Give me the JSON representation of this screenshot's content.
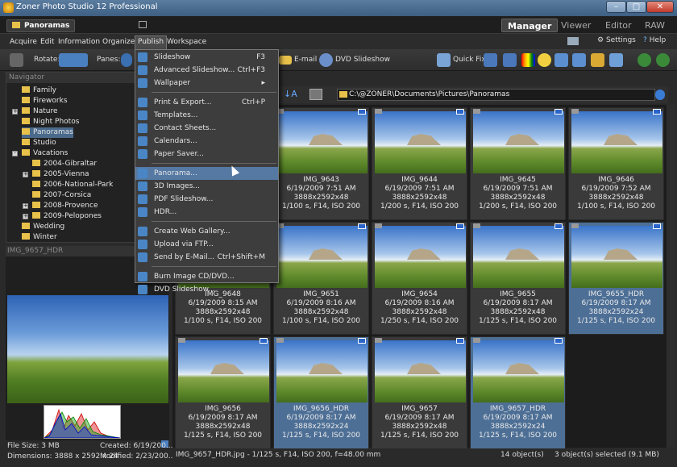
{
  "window": {
    "title": "Zoner Photo Studio 12 Professional",
    "minimize": "–",
    "maximize": "□",
    "close": "✕"
  },
  "topbar": {
    "breadcrumb": "Panoramas",
    "modes": [
      "Manager",
      "Viewer",
      "Editor",
      "RAW"
    ]
  },
  "menu": {
    "items": [
      "Acquire",
      "Edit",
      "Information",
      "Organize",
      "Publish",
      "Workspace"
    ],
    "settings": "Settings",
    "help": "Help"
  },
  "toolbar": {
    "rotate_label": "Rotate:",
    "panes_label": "Panes:",
    "email": "E-mail",
    "dvd": "DVD Slideshow",
    "quickfix": "Quick Fix"
  },
  "navigator": {
    "header": "Navigator",
    "items": [
      {
        "label": "Family",
        "indent": 0,
        "exp": ""
      },
      {
        "label": "Fireworks",
        "indent": 0,
        "exp": ""
      },
      {
        "label": "Nature",
        "indent": 0,
        "exp": "+"
      },
      {
        "label": "Night Photos",
        "indent": 0,
        "exp": ""
      },
      {
        "label": "Panoramas",
        "indent": 0,
        "exp": "",
        "sel": true
      },
      {
        "label": "Studio",
        "indent": 0,
        "exp": ""
      },
      {
        "label": "Vacations",
        "indent": 0,
        "exp": "-"
      },
      {
        "label": "2004-Gibraltar",
        "indent": 1,
        "exp": ""
      },
      {
        "label": "2005-Vienna",
        "indent": 1,
        "exp": "+"
      },
      {
        "label": "2006-National-Park",
        "indent": 1,
        "exp": ""
      },
      {
        "label": "2007-Corsica",
        "indent": 1,
        "exp": ""
      },
      {
        "label": "2008-Provence",
        "indent": 1,
        "exp": "+"
      },
      {
        "label": "2009-Pelopones",
        "indent": 1,
        "exp": "+"
      },
      {
        "label": "Wedding",
        "indent": 0,
        "exp": ""
      },
      {
        "label": "Winter",
        "indent": 0,
        "exp": ""
      }
    ]
  },
  "preview": {
    "title": "IMG_9657_HDR",
    "filesize": "File Size: 3 MB",
    "created": "Created: 6/19/200...",
    "dimensions": "Dimensions: 3888 x 2592 x 24",
    "modified": "Modified: 2/23/200..."
  },
  "path": "C:\\@ZONER\\Documents\\Pictures\\Panoramas",
  "dropdown": [
    {
      "label": "Slideshow",
      "key": "F3"
    },
    {
      "label": "Advanced Slideshow...",
      "key": "Ctrl+F3"
    },
    {
      "label": "Wallpaper",
      "key": "▸"
    },
    {
      "sep": true
    },
    {
      "label": "Print & Export...",
      "key": "Ctrl+P"
    },
    {
      "label": "Templates...",
      "key": ""
    },
    {
      "label": "Contact Sheets...",
      "key": ""
    },
    {
      "label": "Calendars...",
      "key": ""
    },
    {
      "label": "Paper Saver...",
      "key": ""
    },
    {
      "sep": true
    },
    {
      "label": "Panorama...",
      "key": "",
      "hl": true
    },
    {
      "label": "3D Images...",
      "key": ""
    },
    {
      "label": "PDF Slideshow...",
      "key": ""
    },
    {
      "label": "HDR...",
      "key": ""
    },
    {
      "sep": true
    },
    {
      "label": "Create Web Gallery...",
      "key": ""
    },
    {
      "label": "Upload via FTP...",
      "key": ""
    },
    {
      "label": "Send by E-Mail...",
      "key": "Ctrl+Shift+M"
    },
    {
      "sep": true
    },
    {
      "label": "Burn Image CD/DVD...",
      "key": ""
    },
    {
      "label": "DVD Slideshow...",
      "key": ""
    }
  ],
  "thumbs": [
    {
      "name": "IMG_9643",
      "date": "6/19/2009 7:51 AM",
      "dims": "3888x2592x48",
      "exif": "1/100 s, F14, ISO 200"
    },
    {
      "name": "IMG_9644",
      "date": "6/19/2009 7:51 AM",
      "dims": "3888x2592x48",
      "exif": "1/200 s, F14, ISO 200"
    },
    {
      "name": "IMG_9645",
      "date": "6/19/2009 7:51 AM",
      "dims": "3888x2592x48",
      "exif": "1/200 s, F14, ISO 200"
    },
    {
      "name": "IMG_9646",
      "date": "6/19/2009 7:52 AM",
      "dims": "3888x2592x48",
      "exif": "1/100 s, F14, ISO 200"
    },
    {
      "name": "IMG_9648",
      "date": "6/19/2009 8:15 AM",
      "dims": "3888x2592x48",
      "exif": "1/100 s, F14, ISO 200"
    },
    {
      "name": "IMG_9651",
      "date": "6/19/2009 8:16 AM",
      "dims": "3888x2592x48",
      "exif": "1/100 s, F14, ISO 200"
    },
    {
      "name": "IMG_9654",
      "date": "6/19/2009 8:16 AM",
      "dims": "3888x2592x48",
      "exif": "1/250 s, F14, ISO 200"
    },
    {
      "name": "IMG_9655",
      "date": "6/19/2009 8:17 AM",
      "dims": "3888x2592x48",
      "exif": "1/125 s, F14, ISO 200"
    },
    {
      "name": "IMG_9655_HDR",
      "date": "6/19/2009 8:17 AM",
      "dims": "3888x2592x24",
      "exif": "1/125 s, F14, ISO 200",
      "sel": true
    },
    {
      "name": "IMG_9656",
      "date": "6/19/2009 8:17 AM",
      "dims": "3888x2592x48",
      "exif": "1/125 s, F14, ISO 200"
    },
    {
      "name": "IMG_9656_HDR",
      "date": "6/19/2009 8:17 AM",
      "dims": "3888x2592x24",
      "exif": "1/125 s, F14, ISO 200",
      "sel": true
    },
    {
      "name": "IMG_9657",
      "date": "6/19/2009 8:17 AM",
      "dims": "3888x2592x48",
      "exif": "1/125 s, F14, ISO 200"
    },
    {
      "name": "IMG_9657_HDR",
      "date": "6/19/2009 8:17 AM",
      "dims": "3888x2592x24",
      "exif": "1/125 s, F14, ISO 200",
      "sel": true
    }
  ],
  "status": {
    "file": "IMG_9657_HDR.jpg - 1/125 s, F14, ISO 200, f=48.00 mm",
    "count": "14 object(s)",
    "selected": "3 object(s) selected (9.1 MB)"
  }
}
